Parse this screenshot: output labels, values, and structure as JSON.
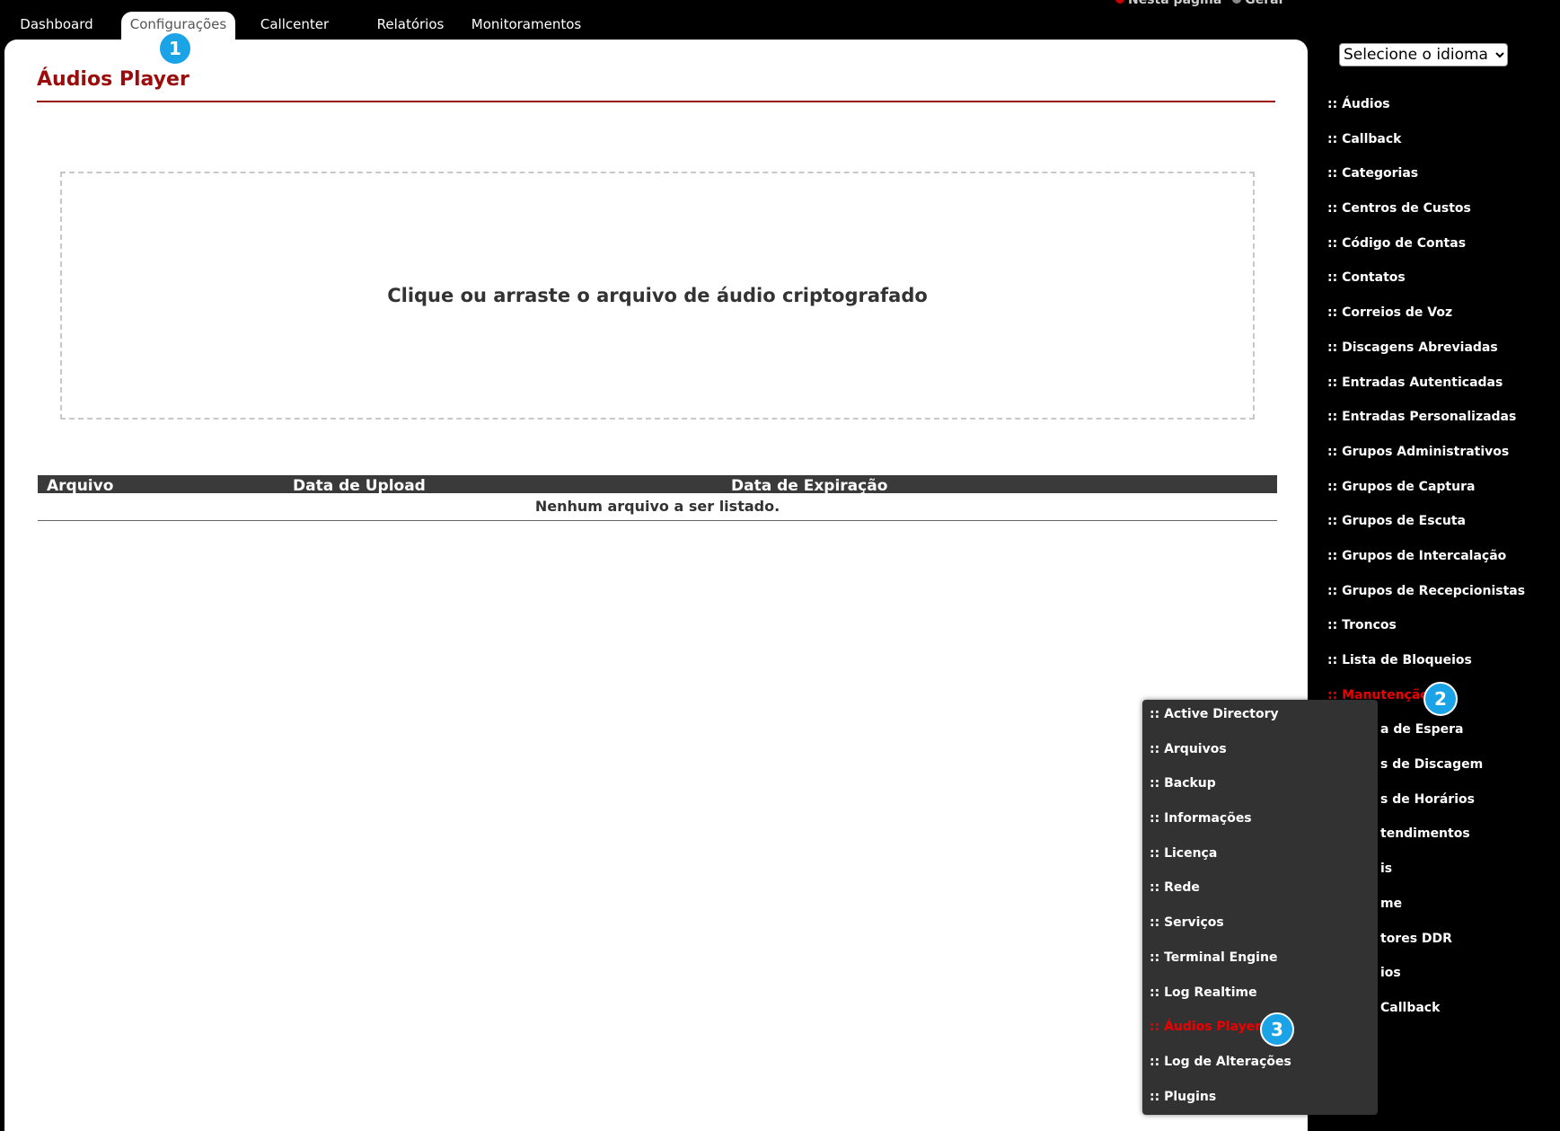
{
  "top_nav": {
    "tabs": [
      {
        "label": "Dashboard"
      },
      {
        "label": "Configurações"
      },
      {
        "label": "Callcenter"
      },
      {
        "label": "Relatórios"
      },
      {
        "label": "Monitoramentos"
      }
    ],
    "active_tab": "Configurações",
    "top_right_links": [
      "Nesta página",
      "Geral"
    ]
  },
  "main": {
    "title": "Áudios Player",
    "dropzone_text": "Clique ou arraste o arquivo de áudio criptografado",
    "table": {
      "columns": [
        "Arquivo",
        "Data de Upload",
        "Data de Expiração"
      ],
      "empty_message": "Nenhum arquivo a ser listado."
    }
  },
  "language_select": {
    "selected": "Selecione o idioma"
  },
  "sidebar": {
    "items": [
      ":: Áudios",
      ":: Callback",
      ":: Categorias",
      ":: Centros de Custos",
      ":: Código de Contas",
      ":: Contatos",
      ":: Correios de Voz",
      ":: Discagens Abreviadas",
      ":: Entradas Autenticadas",
      ":: Entradas Personalizadas",
      ":: Grupos Administrativos",
      ":: Grupos de Captura",
      ":: Grupos de Escuta",
      ":: Grupos de Intercalação",
      ":: Grupos de Recepcionistas",
      ":: Troncos",
      ":: Lista de Bloqueios",
      ":: Manutenção",
      "a de Espera",
      "s de Discagem",
      "s de Horários",
      "tendimentos",
      "is",
      "me",
      "tores DDR",
      "ios",
      "Callback"
    ],
    "active_item": ":: Manutenção"
  },
  "submenu": {
    "items": [
      ":: Active Directory",
      ":: Arquivos",
      ":: Backup",
      ":: Informações",
      ":: Licença",
      ":: Rede",
      ":: Serviços",
      ":: Terminal Engine",
      ":: Log Realtime",
      ":: Áudios Player",
      ":: Log de Alterações",
      ":: Plugins"
    ],
    "active_item": ":: Áudios Player"
  },
  "step_badges": [
    "1",
    "2",
    "3"
  ],
  "colors": {
    "title_red": "#9b0d0d",
    "active_red": "#e00000",
    "badge_blue": "#1aa3e6",
    "submenu_bg": "#323232",
    "table_header_bg": "#3a3a3a"
  }
}
